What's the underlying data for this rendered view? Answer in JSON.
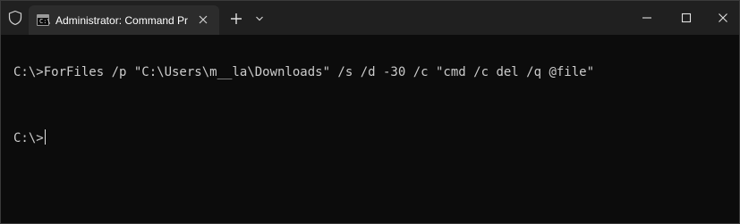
{
  "window": {
    "tab_title": "Administrator: Command Prom",
    "tab_icon_prompt": "C:\\",
    "accent_bg": "#0c0c0c",
    "titlebar_bg": "#202020"
  },
  "icons": {
    "shield": "shield-icon",
    "tab": "command-prompt-icon",
    "close_tab": "close-icon",
    "new_tab": "plus-icon",
    "dropdown": "chevron-down-icon",
    "minimize": "minimize-icon",
    "maximize": "maximize-icon",
    "close_window": "close-icon"
  },
  "terminal": {
    "lines": [
      "C:\\>ForFiles /p \"C:\\Users\\m__la\\Downloads\" /s /d -30 /c \"cmd /c del /q @file\"",
      "C:\\>"
    ]
  }
}
